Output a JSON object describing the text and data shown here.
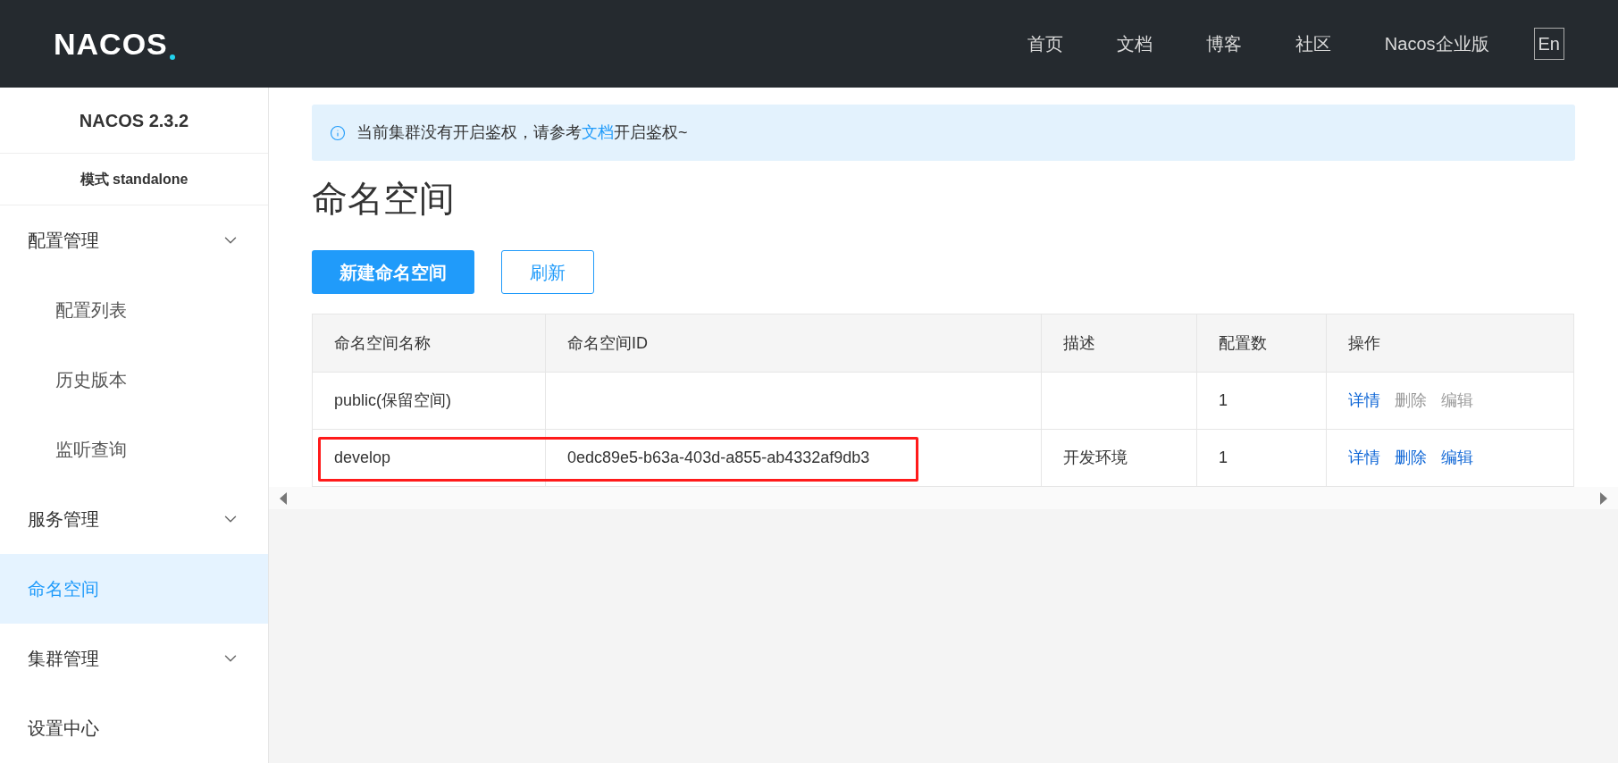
{
  "header": {
    "logo": "NACOS",
    "nav": [
      "首页",
      "文档",
      "博客",
      "社区",
      "Nacos企业版"
    ],
    "language_button": "En"
  },
  "sidebar": {
    "version": "NACOS 2.3.2",
    "mode": "模式 standalone",
    "items": [
      {
        "label": "配置管理",
        "kind": "group",
        "selected": false,
        "children": [
          {
            "label": "配置列表",
            "selected": false
          },
          {
            "label": "历史版本",
            "selected": false
          },
          {
            "label": "监听查询",
            "selected": false
          }
        ]
      },
      {
        "label": "服务管理",
        "kind": "group",
        "selected": false
      },
      {
        "label": "命名空间",
        "kind": "item",
        "selected": true
      },
      {
        "label": "集群管理",
        "kind": "group",
        "selected": false
      },
      {
        "label": "设置中心",
        "kind": "item",
        "selected": false
      }
    ]
  },
  "notice": {
    "before": "当前集群没有开启鉴权，请参考",
    "link": "文档",
    "after": "开启鉴权~"
  },
  "page_title": "命名空间",
  "buttons": [
    {
      "label": "新建命名空间",
      "kind": "primary"
    },
    {
      "label": "刷新",
      "kind": "outline"
    }
  ],
  "table": {
    "columns": [
      "命名空间名称",
      "命名空间ID",
      "描述",
      "配置数",
      "操作"
    ],
    "rows": [
      {
        "name": "public(保留空间)",
        "id": "",
        "description": "",
        "count": "1",
        "highlighted": false,
        "actions": [
          {
            "label": "详情",
            "disabled": false
          },
          {
            "label": "删除",
            "disabled": true
          },
          {
            "label": "编辑",
            "disabled": true
          }
        ]
      },
      {
        "name": "develop",
        "id": "0edc89e5-b63a-403d-a855-ab4332af9db3",
        "description": "开发环境",
        "count": "1",
        "highlighted": true,
        "actions": [
          {
            "label": "详情",
            "disabled": false
          },
          {
            "label": "删除",
            "disabled": false
          },
          {
            "label": "编辑",
            "disabled": false
          }
        ]
      }
    ]
  }
}
